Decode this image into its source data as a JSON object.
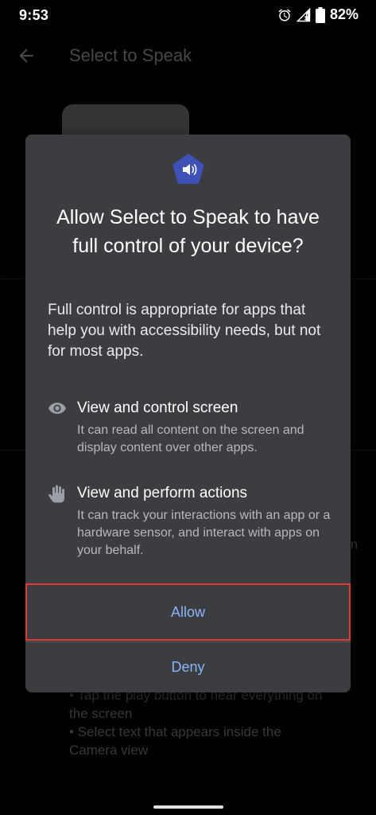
{
  "status_bar": {
    "time": "9:53",
    "battery": "82%",
    "icons": [
      "alarm-icon",
      "signal-icon",
      "battery-icon"
    ]
  },
  "background": {
    "title": "Select to Speak",
    "bullets": [
      "• Tap the play button to hear everything on",
      "the screen",
      "• Select text that appears inside the",
      "Camera view"
    ],
    "peek_text": "n"
  },
  "dialog": {
    "icon": "select-to-speak-app-icon",
    "title": "Allow Select to Speak to have full control of your device?",
    "description": "Full control is appropriate for apps that help you with accessibility needs, but not for most apps.",
    "permissions": [
      {
        "icon": "eye-icon",
        "title": "View and control screen",
        "description": "It can read all content on the screen and display content over other apps."
      },
      {
        "icon": "hand-icon",
        "title": "View and perform actions",
        "description": "It can track your interactions with an app or a hardware sensor, and interact with apps on your behalf."
      }
    ],
    "allow_label": "Allow",
    "deny_label": "Deny"
  },
  "colors": {
    "dialog_bg": "#3c3d40",
    "accent": "#8ab4f8",
    "app_icon": "#3f51b5",
    "highlight": "#e53935"
  }
}
